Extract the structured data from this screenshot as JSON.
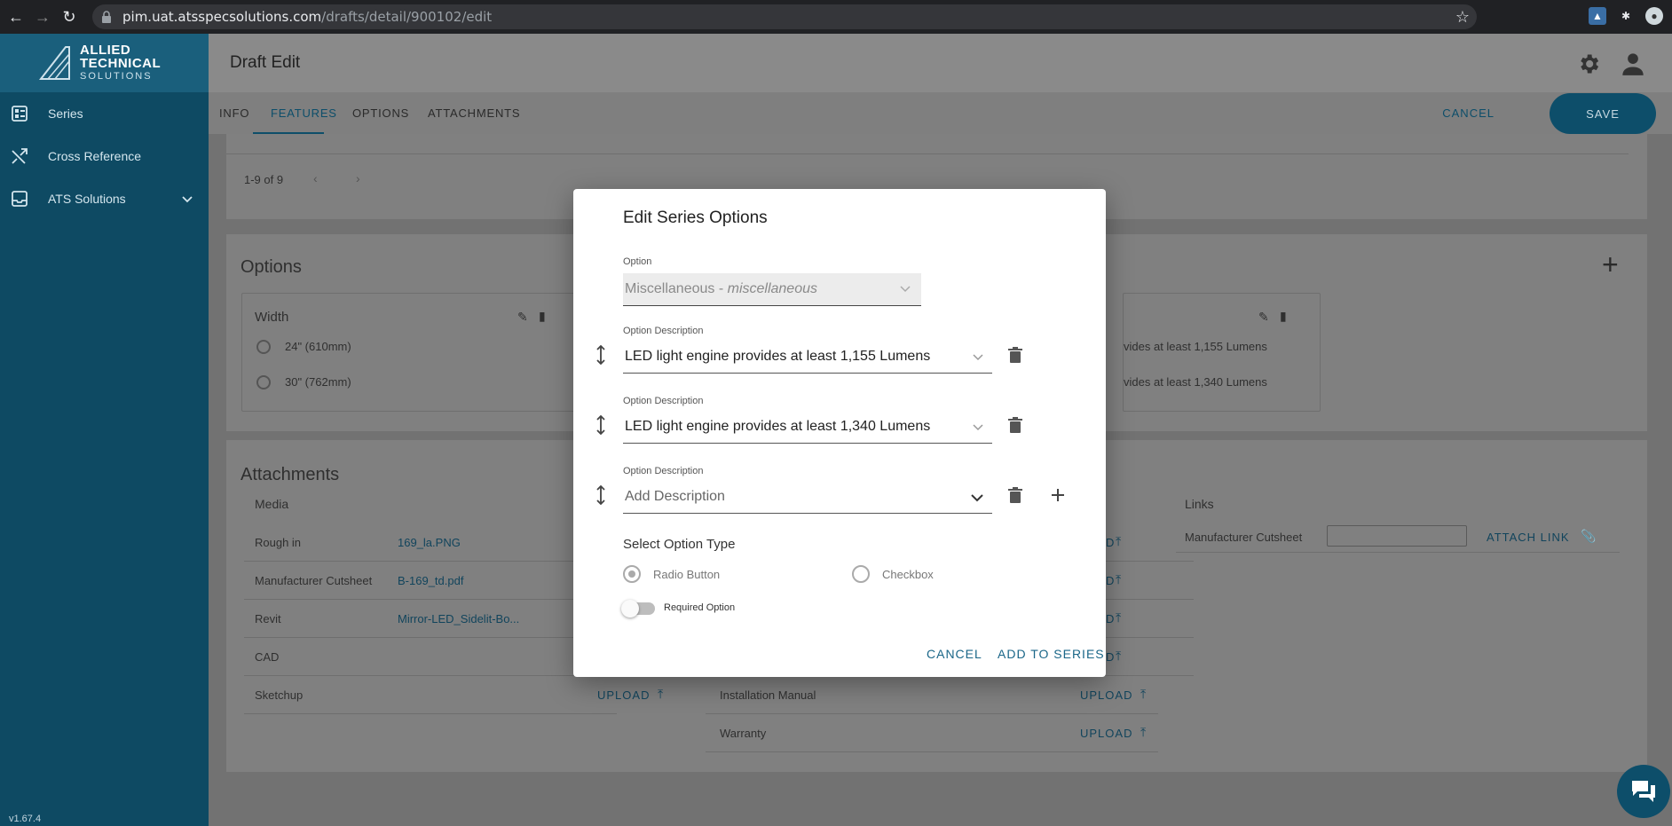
{
  "browser": {
    "url_host": "pim.uat.atsspecsolutions.com",
    "url_path": "/drafts/detail/900102/edit"
  },
  "sidebar": {
    "logo_line1": "ALLIED",
    "logo_line2": "TECHNICAL",
    "logo_line3": "SOLUTIONS",
    "items": [
      {
        "label": "Series",
        "icon": "list-icon"
      },
      {
        "label": "Cross Reference",
        "icon": "shuffle-icon"
      },
      {
        "label": "ATS Solutions",
        "icon": "inbox-icon"
      }
    ],
    "version": "v1.67.4"
  },
  "header": {
    "title": "Draft Edit",
    "tabs": [
      "INFO",
      "FEATURES",
      "OPTIONS",
      "ATTACHMENTS"
    ],
    "active_tab": "FEATURES",
    "cancel_label": "CANCEL",
    "save_label": "SAVE"
  },
  "features": {
    "pagination": "1-9 of 9"
  },
  "options": {
    "title": "Options",
    "card_left": {
      "title": "Width",
      "choices": [
        "24\" (610mm)",
        "30\" (762mm)"
      ]
    },
    "card_right": {
      "choices": [
        "vides at least 1,155 Lumens",
        "vides at least 1,340 Lumens"
      ]
    }
  },
  "attachments": {
    "title": "Attachments",
    "media_header": "Media",
    "links_header": "Links",
    "media_rows": [
      {
        "label": "Rough in",
        "file": "169_la.PNG"
      },
      {
        "label": "Manufacturer Cutsheet",
        "file": "B-169_td.pdf"
      },
      {
        "label": "Revit",
        "file": "Mirror-LED_Sidelit-Bo..."
      },
      {
        "label": "CAD",
        "file": ""
      },
      {
        "label": "Sketchup",
        "file": ""
      }
    ],
    "upload_label": "UPLOAD",
    "doc_rows": [
      {
        "label": "Installation Manual"
      },
      {
        "label": "Warranty"
      }
    ],
    "link_label": "Manufacturer Cutsheet",
    "attach_link_label": "ATTACH LINK"
  },
  "modal": {
    "title": "Edit Series Options",
    "option_label": "Option",
    "option_value_main": "Miscellaneous - ",
    "option_value_italic": "miscellaneous",
    "desc_label": "Option Description",
    "descriptions": [
      "LED light engine provides at least 1,155 Lumens",
      "LED light engine provides at least 1,340 Lumens"
    ],
    "add_placeholder": "Add Description",
    "type_title": "Select Option Type",
    "radio_label": "Radio Button",
    "checkbox_label": "Checkbox",
    "required_label": "Required Option",
    "cancel_label": "CANCEL",
    "add_label": "ADD TO SERIES"
  }
}
